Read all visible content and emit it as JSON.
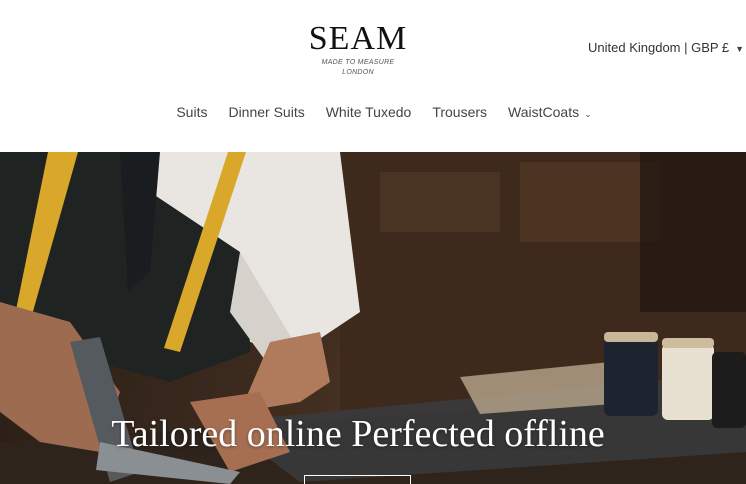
{
  "brand": {
    "name": "SEAM",
    "tagline_1": "MADE TO MEASURE",
    "tagline_2": "LONDON"
  },
  "locale": {
    "label": "United Kingdom | GBP £",
    "icon": "chevron-down-icon"
  },
  "nav": {
    "items": [
      {
        "label": "Suits"
      },
      {
        "label": "Dinner Suits"
      },
      {
        "label": "White Tuxedo"
      },
      {
        "label": "Trousers"
      },
      {
        "label": "WaistCoats",
        "has_dropdown": true
      }
    ]
  },
  "hero": {
    "title": "Tailored online Perfected offline"
  },
  "colors": {
    "measuring_tape": "#d9a82a",
    "hero_dark": "#2a1e16",
    "shirt": "#e9e6e1"
  }
}
